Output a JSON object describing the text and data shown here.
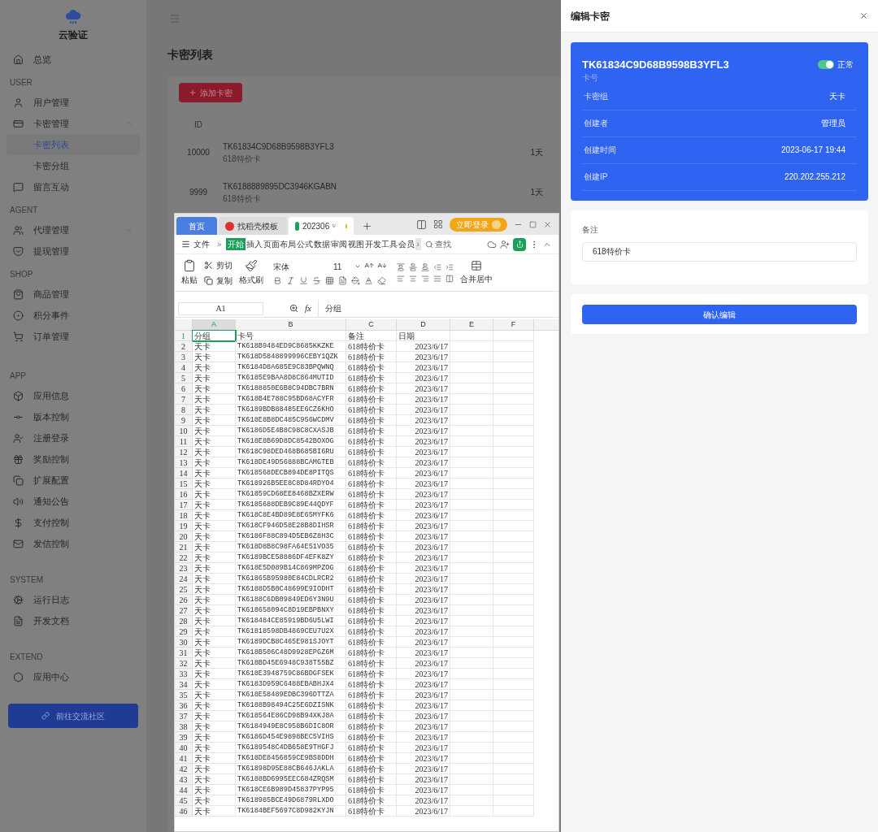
{
  "sidebar": {
    "logo_text": "云验证",
    "sections": [
      {
        "items": [
          {
            "label": "总览",
            "selected": false
          }
        ]
      },
      {
        "heading": "USER",
        "items": [
          {
            "label": "用户管理",
            "selected": false
          },
          {
            "label": "卡密管理",
            "selected": false,
            "expanded": true,
            "children": [
              {
                "label": "卡密列表",
                "selected": true
              },
              {
                "label": "卡密分组",
                "selected": false
              }
            ]
          },
          {
            "label": "留言互动",
            "selected": false
          }
        ]
      },
      {
        "heading": "AGENT",
        "items": [
          {
            "label": "代理管理",
            "selected": false,
            "expanded": false
          },
          {
            "label": "提现管理",
            "selected": false
          }
        ]
      },
      {
        "heading": "SHOP",
        "items": [
          {
            "label": "商品管理",
            "selected": false
          },
          {
            "label": "积分事件",
            "selected": false
          },
          {
            "label": "订单管理",
            "selected": false
          }
        ]
      },
      {
        "heading": "APP",
        "items": [
          {
            "label": "应用信息",
            "selected": false
          },
          {
            "label": "版本控制",
            "selected": false
          },
          {
            "label": "注册登录",
            "selected": false
          },
          {
            "label": "奖励控制",
            "selected": false
          },
          {
            "label": "扩展配置",
            "selected": false
          },
          {
            "label": "通知公告",
            "selected": false
          },
          {
            "label": "支付控制",
            "selected": false
          },
          {
            "label": "发信控制",
            "selected": false
          }
        ]
      },
      {
        "heading": "SYSTEM",
        "items": [
          {
            "label": "运行日志",
            "selected": false
          },
          {
            "label": "开发文档",
            "selected": false
          }
        ]
      },
      {
        "heading": "EXTEND",
        "items": [
          {
            "label": "应用中心",
            "selected": false
          }
        ]
      }
    ],
    "footer_button": "前往交流社区"
  },
  "main": {
    "title": "卡密列表",
    "add_button": "添加卡密",
    "table": {
      "columns": [
        "ID"
      ],
      "rows": [
        {
          "id": "10000",
          "card": "TK61834C9D68B9598B3YFL3",
          "note": "618特价卡",
          "duration": "1天"
        },
        {
          "id": "9999",
          "card": "TK6188889895DC3946KGABN",
          "note": "618特价卡",
          "duration": "1天"
        }
      ]
    }
  },
  "spreadsheet": {
    "tabs": [
      {
        "label": "首页",
        "kind": "home",
        "selected": false
      },
      {
        "label": "找稻壳模板",
        "kind": "template",
        "selected": false
      },
      {
        "label": "202306",
        "kind": "file",
        "selected": true
      }
    ],
    "login_button": "立即登录",
    "menu": {
      "file": "文件",
      "more": "»",
      "tabs": [
        {
          "label": "开始",
          "selected": true
        },
        {
          "label": "插入",
          "selected": false
        },
        {
          "label": "页面布局",
          "selected": false
        },
        {
          "label": "公式",
          "selected": false
        },
        {
          "label": "数据",
          "selected": false
        },
        {
          "label": "审阅",
          "selected": false
        },
        {
          "label": "视图",
          "selected": false
        },
        {
          "label": "开发工具",
          "selected": false
        },
        {
          "label": "会员",
          "selected": false
        }
      ],
      "scroll": "›",
      "search": "查找"
    },
    "toolbar": {
      "paste": "粘贴",
      "cut": "剪切",
      "copy": "复制",
      "format_painter": "格式刷",
      "font": "宋体",
      "size": "11",
      "merge": "合并居中"
    },
    "name_box": "A1",
    "formula_label": "fx",
    "formula": "分组",
    "columns": [
      {
        "label": "A",
        "selected": true
      },
      {
        "label": "B",
        "selected": false
      },
      {
        "label": "C",
        "selected": false
      },
      {
        "label": "D",
        "selected": false
      },
      {
        "label": "E",
        "selected": false
      },
      {
        "label": "F",
        "selected": false
      }
    ],
    "header_row": {
      "n": "1",
      "selected": true,
      "cells": [
        "分组",
        "卡号",
        "备注",
        "日期"
      ]
    },
    "rows": [
      {
        "n": "2",
        "cells": [
          "天卡",
          "TK618B9484ED9C8685KKZKE",
          "618特价卡",
          "2023/6/17"
        ]
      },
      {
        "n": "3",
        "cells": [
          "天卡",
          "TK618D5848899996CEBY1QZK",
          "618特价卡",
          "2023/6/17"
        ]
      },
      {
        "n": "4",
        "cells": [
          "天卡",
          "TK6184D8A685E9C83BPQWNQ",
          "618特价卡",
          "2023/6/17"
        ]
      },
      {
        "n": "5",
        "cells": [
          "天卡",
          "TK6185E9BAA8D8C864MUTID",
          "618特价卡",
          "2023/6/17"
        ]
      },
      {
        "n": "6",
        "cells": [
          "天卡",
          "TK6188850E6B8C94DBC7BRN",
          "618特价卡",
          "2023/6/17"
        ]
      },
      {
        "n": "7",
        "cells": [
          "天卡",
          "TK618B4E788C95BD68ACYFR",
          "618特价卡",
          "2023/6/17"
        ]
      },
      {
        "n": "8",
        "cells": [
          "天卡",
          "TK6189BDB88485EE6CZ6KHO",
          "618特价卡",
          "2023/6/17"
        ]
      },
      {
        "n": "9",
        "cells": [
          "天卡",
          "TK618E8B8DC485C956WCDMV",
          "618特价卡",
          "2023/6/17"
        ]
      },
      {
        "n": "10",
        "cells": [
          "天卡",
          "TK6186D5E4B8C98C8CXASJB",
          "618特价卡",
          "2023/6/17"
        ]
      },
      {
        "n": "11",
        "cells": [
          "天卡",
          "TK618E8B69D8DC8542BOXOG",
          "618特价卡",
          "2023/6/17"
        ]
      },
      {
        "n": "12",
        "cells": [
          "天卡",
          "TK618C98DED468B685BI6RU",
          "618特价卡",
          "2023/6/17"
        ]
      },
      {
        "n": "13",
        "cells": [
          "天卡",
          "TK618DE49D56888BCAMGTEB",
          "618特价卡",
          "2023/6/17"
        ]
      },
      {
        "n": "14",
        "cells": [
          "天卡",
          "TK618568DECB894DE8PITQS",
          "618特价卡",
          "2023/6/17"
        ]
      },
      {
        "n": "15",
        "cells": [
          "天卡",
          "TK618926B5EE8C8D84RDYO4",
          "618特价卡",
          "2023/6/17"
        ]
      },
      {
        "n": "16",
        "cells": [
          "天卡",
          "TK61859CD68EE8468BZXERW",
          "618特价卡",
          "2023/6/17"
        ]
      },
      {
        "n": "17",
        "cells": [
          "天卡",
          "TK6185688DEB9C89E44QDYF",
          "618特价卡",
          "2023/6/17"
        ]
      },
      {
        "n": "18",
        "cells": [
          "天卡",
          "TK618C8E4BD89E8E65MYFK6",
          "618特价卡",
          "2023/6/17"
        ]
      },
      {
        "n": "19",
        "cells": [
          "天卡",
          "TK618CF946D58E28B8DIHSR",
          "618特价卡",
          "2023/6/17"
        ]
      },
      {
        "n": "20",
        "cells": [
          "天卡",
          "TK6186F88C894D5EB6Z8H3C",
          "618特价卡",
          "2023/6/17"
        ]
      },
      {
        "n": "21",
        "cells": [
          "天卡",
          "TK618D8B8C98FA64E51VO35",
          "618特价卡",
          "2023/6/17"
        ]
      },
      {
        "n": "22",
        "cells": [
          "天卡",
          "TK6189BCE58886DF4EFK8ZY",
          "618特价卡",
          "2023/6/17"
        ]
      },
      {
        "n": "23",
        "cells": [
          "天卡",
          "TK618E5D089B14C869MPZOG",
          "618特价卡",
          "2023/6/17"
        ]
      },
      {
        "n": "24",
        "cells": [
          "天卡",
          "TK61865B95980E84CDLRCR2",
          "618特价卡",
          "2023/6/17"
        ]
      },
      {
        "n": "25",
        "cells": [
          "天卡",
          "TK6188D5B0C48699E9IODHT",
          "618特价卡",
          "2023/6/17"
        ]
      },
      {
        "n": "26",
        "cells": [
          "天卡",
          "TK6188C6DB09849ED6Y3N9U",
          "618特价卡",
          "2023/6/17"
        ]
      },
      {
        "n": "27",
        "cells": [
          "天卡",
          "TK618658094C8D19EBPBNXY",
          "618特价卡",
          "2023/6/17"
        ]
      },
      {
        "n": "28",
        "cells": [
          "天卡",
          "TK618484CE85919BD6U5LWI",
          "618特价卡",
          "2023/6/17"
        ]
      },
      {
        "n": "29",
        "cells": [
          "天卡",
          "TK61818598DB4869CEU7U2X",
          "618特价卡",
          "2023/6/17"
        ]
      },
      {
        "n": "30",
        "cells": [
          "天卡",
          "TK6189DCB8C465E981SJOYT",
          "618特价卡",
          "2023/6/17"
        ]
      },
      {
        "n": "31",
        "cells": [
          "天卡",
          "TK618B506C48D9928EPGZ6M",
          "618特价卡",
          "2023/6/17"
        ]
      },
      {
        "n": "32",
        "cells": [
          "天卡",
          "TK618BD45E6948C938T55BZ",
          "618特价卡",
          "2023/6/17"
        ]
      },
      {
        "n": "33",
        "cells": [
          "天卡",
          "TK618E3948759C86BDGFSEK",
          "618特价卡",
          "2023/6/17"
        ]
      },
      {
        "n": "34",
        "cells": [
          "天卡",
          "TK6183D959C6488EBABHJX4",
          "618特价卡",
          "2023/6/17"
        ]
      },
      {
        "n": "35",
        "cells": [
          "天卡",
          "TK618E58489EDBC396DTTZA",
          "618特价卡",
          "2023/6/17"
        ]
      },
      {
        "n": "36",
        "cells": [
          "天卡",
          "TK6188B98494C25E6DZISNK",
          "618特价卡",
          "2023/6/17"
        ]
      },
      {
        "n": "37",
        "cells": [
          "天卡",
          "TK618564E86CD98B94XKJ8A",
          "618特价卡",
          "2023/6/17"
        ]
      },
      {
        "n": "38",
        "cells": [
          "天卡",
          "TK6184949E8C958B6DIC8OR",
          "618特价卡",
          "2023/6/17"
        ]
      },
      {
        "n": "39",
        "cells": [
          "天卡",
          "TK6186D454E9898BEC5VIHS",
          "618特价卡",
          "2023/6/17"
        ]
      },
      {
        "n": "40",
        "cells": [
          "天卡",
          "TK6189548C4DB658E9THGFJ",
          "618特价卡",
          "2023/6/17"
        ]
      },
      {
        "n": "41",
        "cells": [
          "天卡",
          "TK618DE8456859CE9BS8DDH",
          "618特价卡",
          "2023/6/17"
        ]
      },
      {
        "n": "42",
        "cells": [
          "天卡",
          "TK61898D95E88CB646JAKLA",
          "618特价卡",
          "2023/6/17"
        ]
      },
      {
        "n": "43",
        "cells": [
          "天卡",
          "TK6188BD6995EEC684ZRQSM",
          "618特价卡",
          "2023/6/17"
        ]
      },
      {
        "n": "44",
        "cells": [
          "天卡",
          "TK618CE6B989D45837PYP95",
          "618特价卡",
          "2023/6/17"
        ]
      },
      {
        "n": "45",
        "cells": [
          "天卡",
          "TK618985BCE49D6879RLXDO",
          "618特价卡",
          "2023/6/17"
        ]
      },
      {
        "n": "46",
        "cells": [
          "天卡",
          "TK6184BEF5697C8D982KYJN",
          "618特价卡",
          "2023/6/17"
        ]
      }
    ]
  },
  "drawer": {
    "title": "编辑卡密",
    "card": {
      "code": "TK61834C9D68B9598B3YFL3",
      "code_label": "卡号",
      "status": {
        "label": "正常",
        "on": true
      },
      "fields": [
        {
          "label": "卡密组",
          "value": "天卡"
        },
        {
          "label": "创建者",
          "value": "管理员"
        },
        {
          "label": "创建时间",
          "value": "2023-06-17 19:44"
        },
        {
          "label": "创建IP",
          "value": "220.202.255.212"
        }
      ]
    },
    "note": {
      "label": "备注",
      "value": "618特价卡"
    },
    "submit": "确认编辑"
  }
}
